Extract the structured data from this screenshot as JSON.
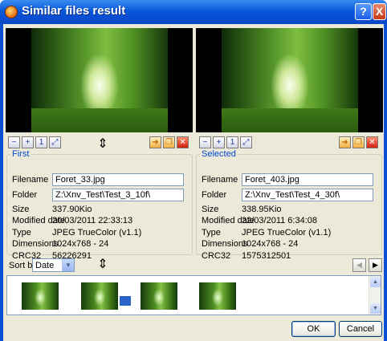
{
  "window": {
    "title": "Similar files result",
    "help_label": "?",
    "close_label": "X"
  },
  "first": {
    "group_label": "First",
    "filename_label": "Filename",
    "filename": "Foret_33.jpg",
    "folder_label": "Folder",
    "folder": "Z:\\Xnv_Test\\Test_3_10f\\",
    "size_label": "Size",
    "size": "337.90Kio",
    "modified_label": "Modified date",
    "modified": "20/03/2011 22:33:13",
    "type_label": "Type",
    "type": "JPEG TrueColor (v1.1)",
    "dimensions_label": "Dimensions",
    "dimensions": "1024x768 - 24",
    "crc_label": "CRC32",
    "crc": "56226291"
  },
  "selected": {
    "group_label": "Selected",
    "filename_label": "Filename",
    "filename": "Foret_403.jpg",
    "folder_label": "Folder",
    "folder": "Z:\\Xnv_Test\\Test_4_30f\\",
    "size_label": "Size",
    "size": "338.95Kio",
    "modified_label": "Modified date",
    "modified": "22/03/2011 6:34:08",
    "type_label": "Type",
    "type": "JPEG TrueColor (v1.1)",
    "dimensions_label": "Dimensions",
    "dimensions": "1024x768 - 24",
    "crc_label": "CRC32",
    "crc": "1575312501"
  },
  "sort": {
    "label": "Sort by",
    "value": "Date"
  },
  "buttons": {
    "ok": "OK",
    "cancel": "Cancel"
  },
  "icons": {
    "zoom_out": "zoom-out-icon",
    "zoom_in": "zoom-in-icon",
    "zoom_actual": "zoom-100-icon",
    "fit": "fit-window-icon",
    "move": "move-file-icon",
    "copy": "copy-file-icon",
    "delete": "delete-icon",
    "splitter": "splitter-icon",
    "prev": "prev-icon",
    "next": "next-icon"
  },
  "colors": {
    "title_bar": "#0a4fd4",
    "group_label": "#0046d5",
    "dialog_bg": "#ece9d8"
  }
}
